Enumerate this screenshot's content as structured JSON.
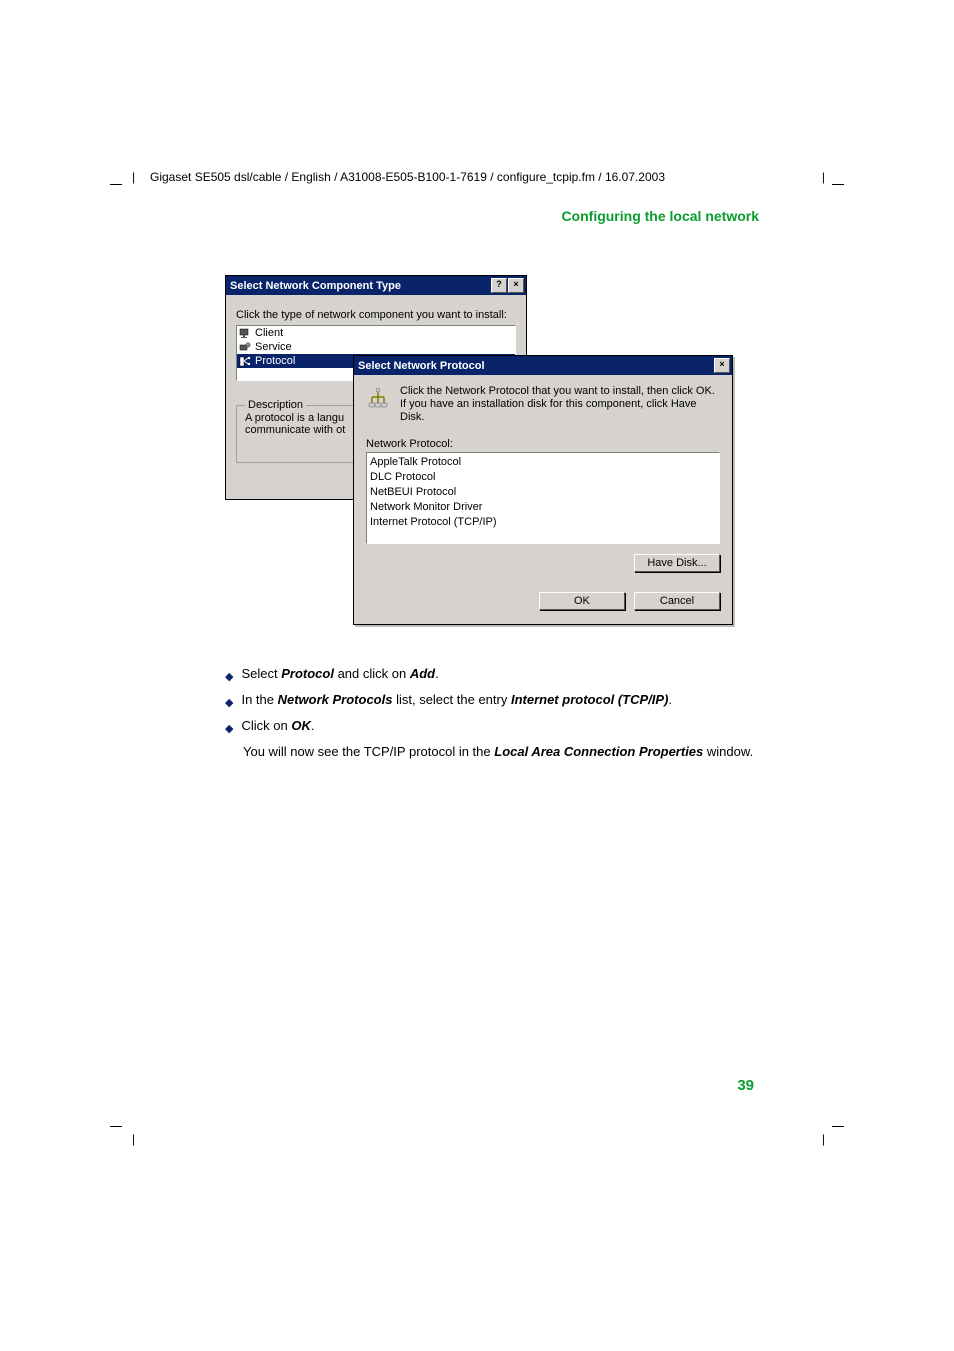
{
  "header_path": "Gigaset SE505 dsl/cable / English / A31008-E505-B100-1-7619 / configure_tcpip.fm / 16.07.2003",
  "section_title": "Configuring the local network",
  "page_number": "39",
  "dialog1": {
    "title": "Select Network Component Type",
    "prompt": "Click the type of network component you want to install:",
    "items": [
      "Client",
      "Service",
      "Protocol"
    ],
    "selected_index": 2,
    "description_label": "Description",
    "description_line1": "A protocol is a langu",
    "description_line2": "communicate with ot"
  },
  "dialog2": {
    "title": "Select Network Protocol",
    "instruction": "Click the Network Protocol that you want to install, then click OK. If you have an installation disk for this component, click Have Disk.",
    "list_label": "Network Protocol:",
    "protocols": [
      "AppleTalk Protocol",
      "DLC Protocol",
      "NetBEUI Protocol",
      "Network Monitor Driver",
      "Internet Protocol (TCP/IP)"
    ],
    "have_disk_label": "Have Disk...",
    "ok_label": "OK",
    "cancel_label": "Cancel"
  },
  "steps": {
    "s1_pre": "Select ",
    "s1_b1": "Protocol",
    "s1_mid": " and click on ",
    "s1_b2": "Add",
    "s1_post": ".",
    "s2_pre": "In the ",
    "s2_b1": "Network Protocols",
    "s2_mid": " list, select the entry ",
    "s2_b2": "Internet protocol (TCP/IP)",
    "s2_post": ".",
    "s3_pre": "Click on ",
    "s3_b1": "OK",
    "s3_post": ".",
    "s3_follow_pre": "You will now see the TCP/IP protocol in the ",
    "s3_follow_b": "Local Area Connection Properties",
    "s3_follow_post": " window."
  }
}
